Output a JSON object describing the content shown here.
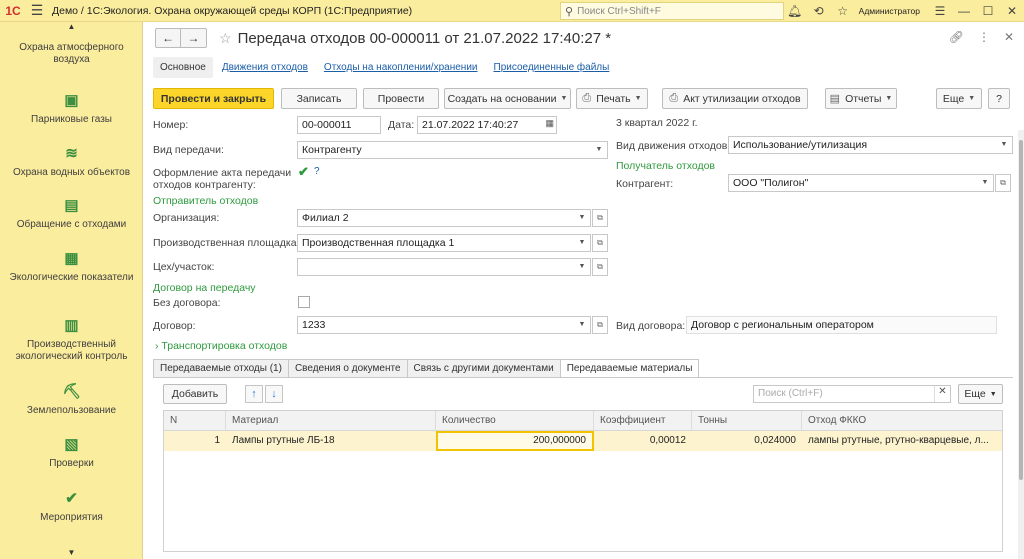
{
  "app": {
    "logo": "1С",
    "title": "Демо / 1С:Экология. Охрана окружающей среды КОРП   (1С:Предприятие)",
    "search_placeholder": "Поиск Ctrl+Shift+F",
    "user": "Администратор"
  },
  "sidebar": {
    "items": [
      {
        "label": "Охрана атмосферного воздуха",
        "icon": "cloud-icon"
      },
      {
        "label": "Парниковые газы",
        "icon": "co2-icon"
      },
      {
        "label": "Охрана водных объектов",
        "icon": "water-icon"
      },
      {
        "label": "Обращение с отходами",
        "icon": "waste-icon"
      },
      {
        "label": "Экологические показатели",
        "icon": "indicators-icon"
      },
      {
        "label": "Производственный экологический контроль",
        "icon": "control-icon"
      },
      {
        "label": "Землепользование",
        "icon": "land-icon"
      },
      {
        "label": "Проверки",
        "icon": "checks-icon"
      },
      {
        "label": "Мероприятия",
        "icon": "measures-icon"
      }
    ]
  },
  "document": {
    "title": "Передача отходов 00-000011 от 21.07.2022 17:40:27 *",
    "tabs": [
      "Основное",
      "Движения отходов",
      "Отходы на накоплении/хранении",
      "Присоединенные файлы"
    ]
  },
  "toolbar": {
    "post_close": "Провести и закрыть",
    "save": "Записать",
    "post": "Провести",
    "create_based": "Создать на основании",
    "print": "Печать",
    "act": "Акт утилизации отходов",
    "reports": "Отчеты",
    "more": "Еще",
    "help": "?"
  },
  "form": {
    "number_label": "Номер:",
    "number_value": "00-000011",
    "date_label": "Дата:",
    "date_value": "21.07.2022 17:40:27",
    "period": "3 квартал 2022 г.",
    "transfer_type_label": "Вид передачи:",
    "transfer_type_value": "Контрагенту",
    "movement_type_label": "Вид движения отходов:",
    "movement_type_value": "Использование/утилизация",
    "act_label_line1": "Оформление акта передачи",
    "act_label_line2": "отходов контрагенту:",
    "act_help": "?",
    "recipient_header": "Получатель отходов",
    "counterparty_label": "Контрагент:",
    "counterparty_value": "ООО \"Полигон\"",
    "sender_header": "Отправитель отходов",
    "organization_label": "Организация:",
    "organization_value": "Филиал 2",
    "site_label": "Производственная площадка:",
    "site_value": "Производственная площадка 1",
    "department_label": "Цех/участок:",
    "department_value": "",
    "contract_header": "Договор на передачу",
    "no_contract_label": "Без договора:",
    "contract_label": "Договор:",
    "contract_value": "1233",
    "contract_kind_label": "Вид договора:",
    "contract_kind_value": "Договор с региональным оператором",
    "transport_section": "Транспортировка отходов"
  },
  "inner_tabs": [
    "Передаваемые отходы (1)",
    "Сведения о документе",
    "Связь с другими документами",
    "Передаваемые материалы"
  ],
  "table_toolbar": {
    "add": "Добавить",
    "search_placeholder": "Поиск (Ctrl+F)",
    "more": "Еще"
  },
  "table": {
    "columns": [
      "N",
      "Материал",
      "Количество",
      "Коэффициент",
      "Тонны",
      "Отход ФККО"
    ],
    "rows": [
      [
        "1",
        "Лампы ртутные ЛБ-18",
        "200,000000",
        "0,00012",
        "0,024000",
        "лампы ртутные, ртутно-кварцевые, л..."
      ]
    ]
  }
}
